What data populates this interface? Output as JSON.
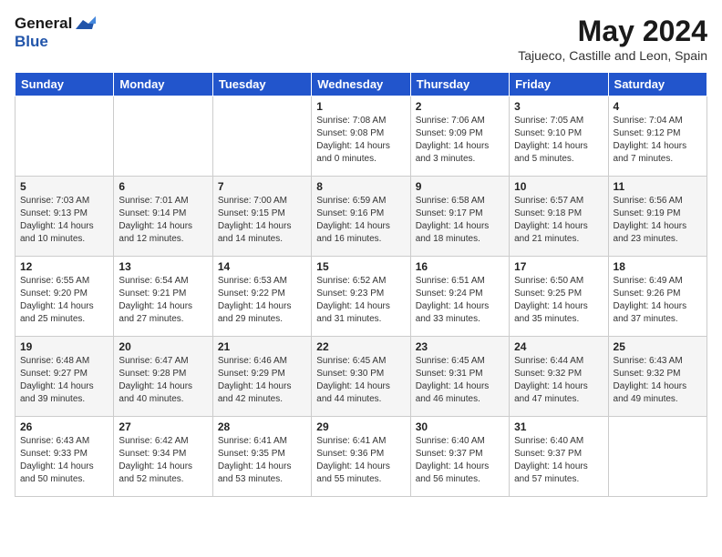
{
  "header": {
    "logo_general": "General",
    "logo_blue": "Blue",
    "month_year": "May 2024",
    "location": "Tajueco, Castille and Leon, Spain"
  },
  "weekdays": [
    "Sunday",
    "Monday",
    "Tuesday",
    "Wednesday",
    "Thursday",
    "Friday",
    "Saturday"
  ],
  "weeks": [
    [
      {
        "day": "",
        "sunrise": "",
        "sunset": "",
        "daylight": ""
      },
      {
        "day": "",
        "sunrise": "",
        "sunset": "",
        "daylight": ""
      },
      {
        "day": "",
        "sunrise": "",
        "sunset": "",
        "daylight": ""
      },
      {
        "day": "1",
        "sunrise": "Sunrise: 7:08 AM",
        "sunset": "Sunset: 9:08 PM",
        "daylight": "Daylight: 14 hours and 0 minutes."
      },
      {
        "day": "2",
        "sunrise": "Sunrise: 7:06 AM",
        "sunset": "Sunset: 9:09 PM",
        "daylight": "Daylight: 14 hours and 3 minutes."
      },
      {
        "day": "3",
        "sunrise": "Sunrise: 7:05 AM",
        "sunset": "Sunset: 9:10 PM",
        "daylight": "Daylight: 14 hours and 5 minutes."
      },
      {
        "day": "4",
        "sunrise": "Sunrise: 7:04 AM",
        "sunset": "Sunset: 9:12 PM",
        "daylight": "Daylight: 14 hours and 7 minutes."
      }
    ],
    [
      {
        "day": "5",
        "sunrise": "Sunrise: 7:03 AM",
        "sunset": "Sunset: 9:13 PM",
        "daylight": "Daylight: 14 hours and 10 minutes."
      },
      {
        "day": "6",
        "sunrise": "Sunrise: 7:01 AM",
        "sunset": "Sunset: 9:14 PM",
        "daylight": "Daylight: 14 hours and 12 minutes."
      },
      {
        "day": "7",
        "sunrise": "Sunrise: 7:00 AM",
        "sunset": "Sunset: 9:15 PM",
        "daylight": "Daylight: 14 hours and 14 minutes."
      },
      {
        "day": "8",
        "sunrise": "Sunrise: 6:59 AM",
        "sunset": "Sunset: 9:16 PM",
        "daylight": "Daylight: 14 hours and 16 minutes."
      },
      {
        "day": "9",
        "sunrise": "Sunrise: 6:58 AM",
        "sunset": "Sunset: 9:17 PM",
        "daylight": "Daylight: 14 hours and 18 minutes."
      },
      {
        "day": "10",
        "sunrise": "Sunrise: 6:57 AM",
        "sunset": "Sunset: 9:18 PM",
        "daylight": "Daylight: 14 hours and 21 minutes."
      },
      {
        "day": "11",
        "sunrise": "Sunrise: 6:56 AM",
        "sunset": "Sunset: 9:19 PM",
        "daylight": "Daylight: 14 hours and 23 minutes."
      }
    ],
    [
      {
        "day": "12",
        "sunrise": "Sunrise: 6:55 AM",
        "sunset": "Sunset: 9:20 PM",
        "daylight": "Daylight: 14 hours and 25 minutes."
      },
      {
        "day": "13",
        "sunrise": "Sunrise: 6:54 AM",
        "sunset": "Sunset: 9:21 PM",
        "daylight": "Daylight: 14 hours and 27 minutes."
      },
      {
        "day": "14",
        "sunrise": "Sunrise: 6:53 AM",
        "sunset": "Sunset: 9:22 PM",
        "daylight": "Daylight: 14 hours and 29 minutes."
      },
      {
        "day": "15",
        "sunrise": "Sunrise: 6:52 AM",
        "sunset": "Sunset: 9:23 PM",
        "daylight": "Daylight: 14 hours and 31 minutes."
      },
      {
        "day": "16",
        "sunrise": "Sunrise: 6:51 AM",
        "sunset": "Sunset: 9:24 PM",
        "daylight": "Daylight: 14 hours and 33 minutes."
      },
      {
        "day": "17",
        "sunrise": "Sunrise: 6:50 AM",
        "sunset": "Sunset: 9:25 PM",
        "daylight": "Daylight: 14 hours and 35 minutes."
      },
      {
        "day": "18",
        "sunrise": "Sunrise: 6:49 AM",
        "sunset": "Sunset: 9:26 PM",
        "daylight": "Daylight: 14 hours and 37 minutes."
      }
    ],
    [
      {
        "day": "19",
        "sunrise": "Sunrise: 6:48 AM",
        "sunset": "Sunset: 9:27 PM",
        "daylight": "Daylight: 14 hours and 39 minutes."
      },
      {
        "day": "20",
        "sunrise": "Sunrise: 6:47 AM",
        "sunset": "Sunset: 9:28 PM",
        "daylight": "Daylight: 14 hours and 40 minutes."
      },
      {
        "day": "21",
        "sunrise": "Sunrise: 6:46 AM",
        "sunset": "Sunset: 9:29 PM",
        "daylight": "Daylight: 14 hours and 42 minutes."
      },
      {
        "day": "22",
        "sunrise": "Sunrise: 6:45 AM",
        "sunset": "Sunset: 9:30 PM",
        "daylight": "Daylight: 14 hours and 44 minutes."
      },
      {
        "day": "23",
        "sunrise": "Sunrise: 6:45 AM",
        "sunset": "Sunset: 9:31 PM",
        "daylight": "Daylight: 14 hours and 46 minutes."
      },
      {
        "day": "24",
        "sunrise": "Sunrise: 6:44 AM",
        "sunset": "Sunset: 9:32 PM",
        "daylight": "Daylight: 14 hours and 47 minutes."
      },
      {
        "day": "25",
        "sunrise": "Sunrise: 6:43 AM",
        "sunset": "Sunset: 9:32 PM",
        "daylight": "Daylight: 14 hours and 49 minutes."
      }
    ],
    [
      {
        "day": "26",
        "sunrise": "Sunrise: 6:43 AM",
        "sunset": "Sunset: 9:33 PM",
        "daylight": "Daylight: 14 hours and 50 minutes."
      },
      {
        "day": "27",
        "sunrise": "Sunrise: 6:42 AM",
        "sunset": "Sunset: 9:34 PM",
        "daylight": "Daylight: 14 hours and 52 minutes."
      },
      {
        "day": "28",
        "sunrise": "Sunrise: 6:41 AM",
        "sunset": "Sunset: 9:35 PM",
        "daylight": "Daylight: 14 hours and 53 minutes."
      },
      {
        "day": "29",
        "sunrise": "Sunrise: 6:41 AM",
        "sunset": "Sunset: 9:36 PM",
        "daylight": "Daylight: 14 hours and 55 minutes."
      },
      {
        "day": "30",
        "sunrise": "Sunrise: 6:40 AM",
        "sunset": "Sunset: 9:37 PM",
        "daylight": "Daylight: 14 hours and 56 minutes."
      },
      {
        "day": "31",
        "sunrise": "Sunrise: 6:40 AM",
        "sunset": "Sunset: 9:37 PM",
        "daylight": "Daylight: 14 hours and 57 minutes."
      },
      {
        "day": "",
        "sunrise": "",
        "sunset": "",
        "daylight": ""
      }
    ]
  ]
}
